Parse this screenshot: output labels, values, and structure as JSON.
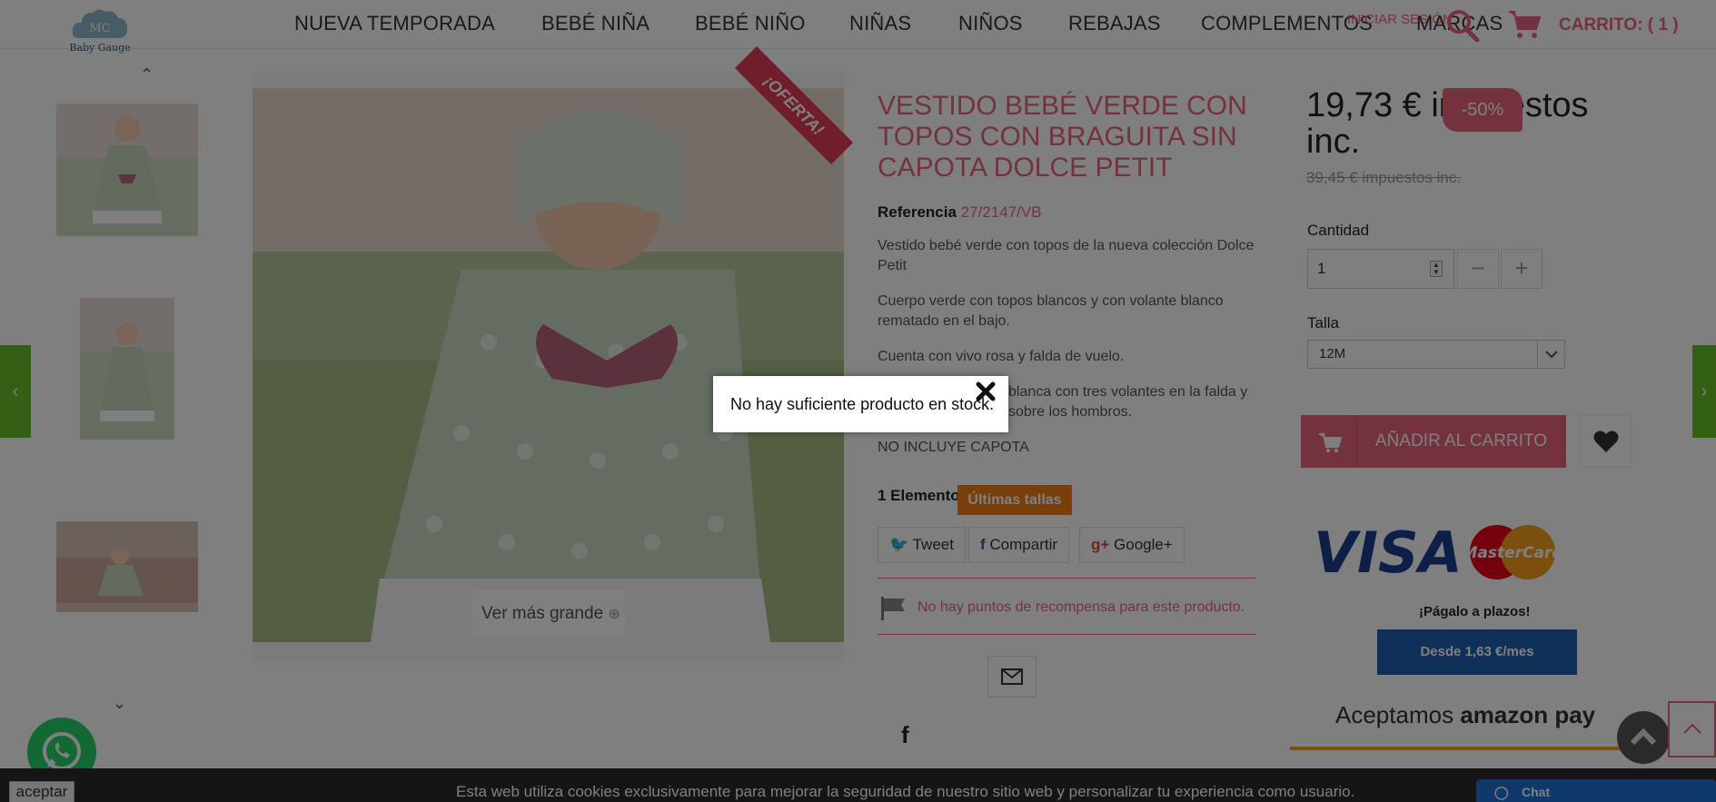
{
  "header": {
    "logo_text": "Baby Gauge",
    "logo_mark": "MC",
    "nav": [
      "NUEVA TEMPORADA",
      "BEBÉ NIÑA",
      "BEBÉ NIÑO",
      "NIÑAS",
      "NIÑOS",
      "REBAJAS",
      "COMPLEMENTOS",
      "MARCAS"
    ],
    "login": "INICIAR SESIÓN",
    "cart": "CARRITO: ( 1 )"
  },
  "gallery": {
    "ribbon": "¡OFERTA!",
    "view_larger": "Ver más grande"
  },
  "product": {
    "title": "VESTIDO BEBÉ VERDE CON TOPOS CON BRAGUITA SIN CAPOTA DOLCE PETIT",
    "ref_label": "Referencia",
    "ref_value": "27/2147/VB",
    "desc1": "Vestido bebé verde con topos de la nueva colección Dolce Petit",
    "desc2": "Cuerpo verde con topos blancos y con volante blanco rematado en el bajo.",
    "desc3": "Cuenta con vivo rosa y falda de vuelo.",
    "desc4a": "blanca con tres volantes en la falda y",
    "desc4b": "sobre los hombros.",
    "desc5": "NO INCLUYE CAPOTA",
    "stock": "1 Elemento",
    "badge": "Últimas tallas",
    "tweet": "Tweet",
    "share": "Compartir",
    "gplus": "Google+",
    "reward": "No hay puntos de recompensa para este producto."
  },
  "purchase": {
    "price": "19,73 € impuestos inc.",
    "discount": "-50%",
    "old_price": "39,45 € impuestos inc.",
    "qty_label": "Cantidad",
    "qty_value": "1",
    "minus": "−",
    "plus": "+",
    "size_label": "Talla",
    "size_value": "12M",
    "add_to_cart": "AÑADIR AL CARRITO",
    "pay_later": "¡Págalo a plazos!",
    "from_month": "Desde 1,63 €/mes",
    "amazon_text": "Aceptamos",
    "amazon_brand": "amazon pay"
  },
  "cookie": {
    "accept": "aceptar",
    "text": "Esta web utiliza cookies exclusivamente para mejorar la seguridad de nuestro sitio web y personalizar tu experiencia como usuario."
  },
  "chat": "Chat",
  "modal": {
    "message": "No hay suficiente producto en stock."
  },
  "colors": {
    "accent": "#e8657d",
    "badge_orange": "#f07f16",
    "side_green": "#6bbf2a",
    "finance_blue": "#1f63b3"
  }
}
